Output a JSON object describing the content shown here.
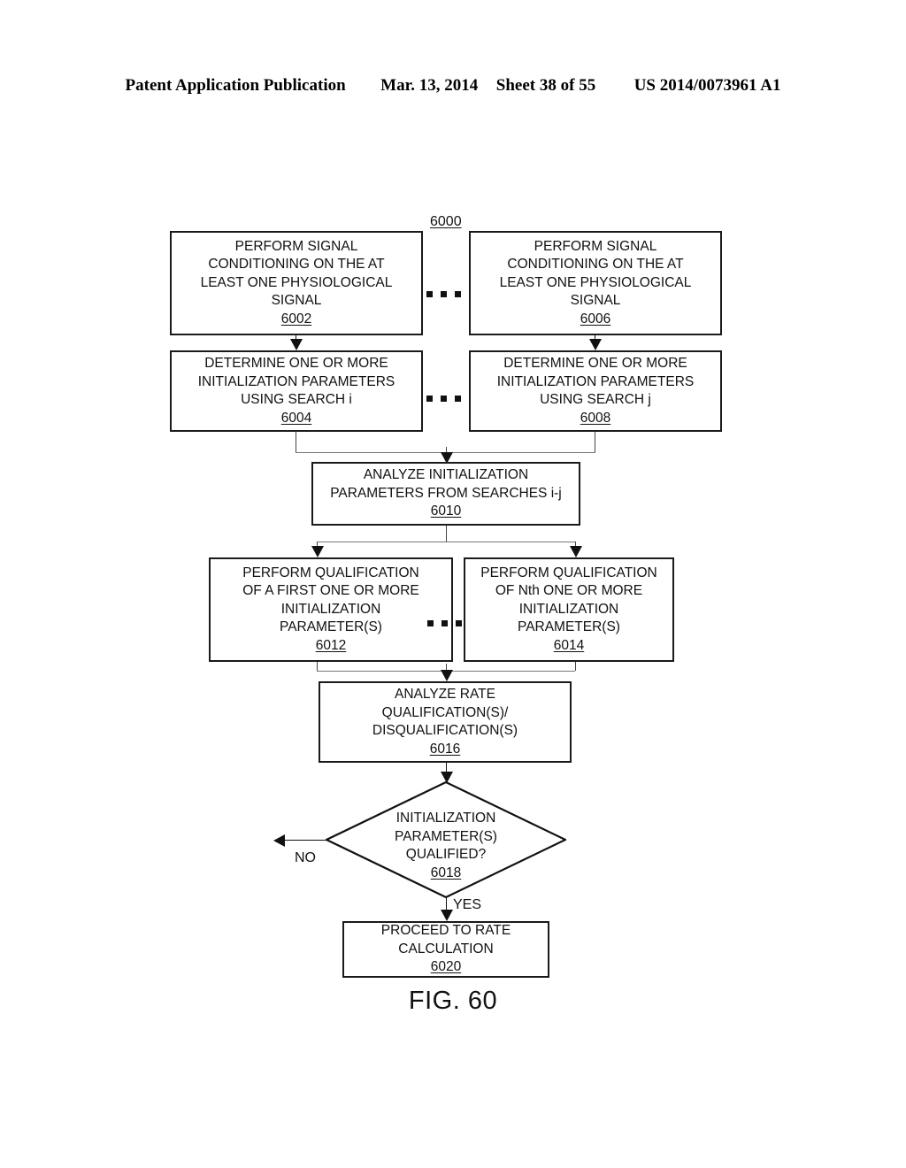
{
  "header": {
    "publication": "Patent Application Publication",
    "date": "Mar. 13, 2014",
    "sheet": "Sheet 38 of 55",
    "patent_number": "US 2014/0073961 A1"
  },
  "figure": {
    "caption": "FIG. 60",
    "diagram_ref": "6000",
    "branch_no": "NO",
    "branch_yes": "YES",
    "nodes": {
      "n6002": {
        "text": "PERFORM SIGNAL\nCONDITIONING ON THE AT\nLEAST ONE PHYSIOLOGICAL\nSIGNAL",
        "ref": "6002"
      },
      "n6006": {
        "text": "PERFORM SIGNAL\nCONDITIONING ON THE AT\nLEAST ONE PHYSIOLOGICAL\nSIGNAL",
        "ref": "6006"
      },
      "n6004": {
        "text": "DETERMINE ONE OR MORE\nINITIALIZATION PARAMETERS\nUSING SEARCH i",
        "ref": "6004"
      },
      "n6008": {
        "text": "DETERMINE ONE OR MORE\nINITIALIZATION PARAMETERS\nUSING SEARCH j",
        "ref": "6008"
      },
      "n6010": {
        "text": "ANALYZE INITIALIZATION\nPARAMETERS FROM SEARCHES i-j",
        "ref": "6010"
      },
      "n6012": {
        "text": "PERFORM QUALIFICATION\nOF A FIRST ONE OR MORE\nINITIALIZATION\nPARAMETER(S)",
        "ref": "6012"
      },
      "n6014": {
        "text": "PERFORM QUALIFICATION\nOF Nth ONE OR MORE\nINITIALIZATION\nPARAMETER(S)",
        "ref": "6014"
      },
      "n6016": {
        "text": "ANALYZE RATE\nQUALIFICATION(S)/\nDISQUALIFICATION(S)",
        "ref": "6016"
      },
      "n6018": {
        "text": "INITIALIZATION\nPARAMETER(S)\nQUALIFIED?",
        "ref": "6018"
      },
      "n6020": {
        "text": "PROCEED TO RATE\nCALCULATION",
        "ref": "6020"
      }
    }
  }
}
